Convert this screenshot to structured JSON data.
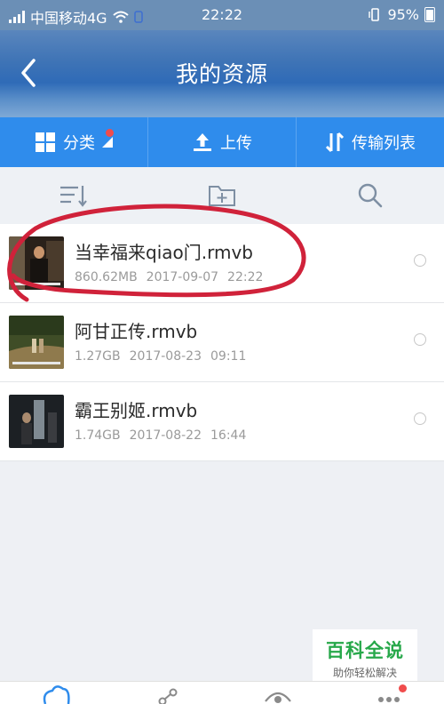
{
  "status_bar": {
    "carrier": "中国移动4G",
    "time": "22:22",
    "battery": "95%"
  },
  "header": {
    "title": "我的资源",
    "back_icon": "back-arrow-icon"
  },
  "toolbar": {
    "items": [
      {
        "label": "分类",
        "icon": "grid-icon"
      },
      {
        "label": "上传",
        "icon": "upload-icon"
      },
      {
        "label": "传输列表",
        "icon": "transfer-arrows-icon"
      }
    ]
  },
  "actions": {
    "icons": [
      "sort-icon",
      "new-folder-icon",
      "search-icon"
    ]
  },
  "files": [
    {
      "name": "当幸福来qiao门.rmvb",
      "size": "860.62MB",
      "date": "2017-09-07",
      "time": "22:22"
    },
    {
      "name": "阿甘正传.rmvb",
      "size": "1.27GB",
      "date": "2017-08-23",
      "time": "09:11"
    },
    {
      "name": "霸王别姬.rmvb",
      "size": "1.74GB",
      "date": "2017-08-22",
      "time": "16:44"
    }
  ],
  "watermark": {
    "title": "百科全说",
    "subtitle": "助你轻松解决"
  },
  "bottom_nav": {
    "icons": [
      "cloud-icon",
      "share-icon",
      "eye-icon",
      "more-icon"
    ]
  },
  "colors": {
    "toolbar": "#2f8cec",
    "annotation": "#d0223a",
    "badge": "#f04c4c",
    "watermark": "#27a84a"
  }
}
